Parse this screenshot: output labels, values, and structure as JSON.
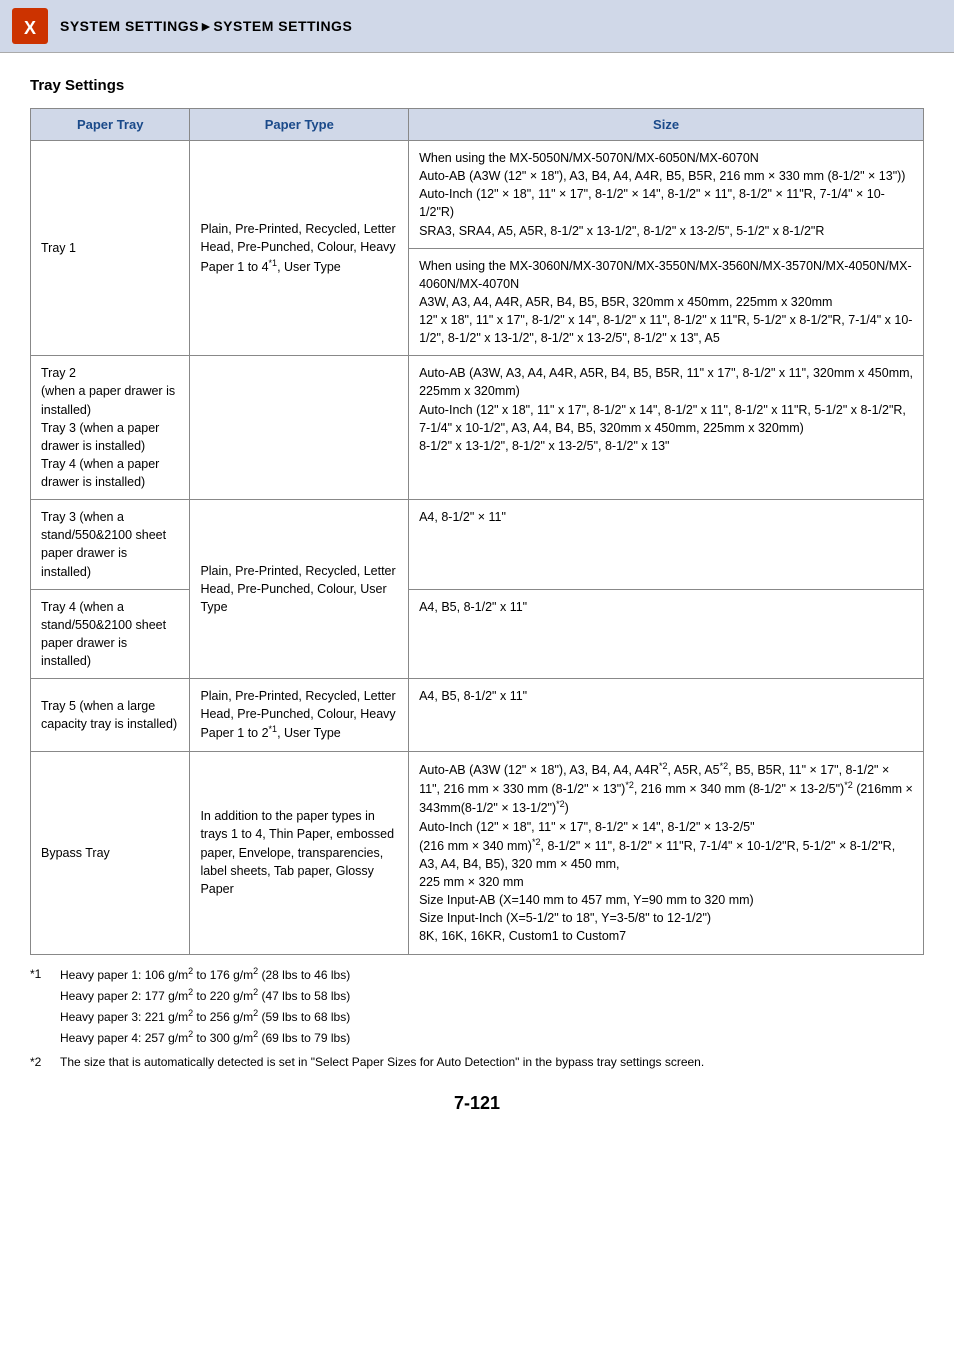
{
  "header": {
    "title": "SYSTEM SETTINGS►SYSTEM SETTINGS",
    "logo_alt": "Sharp logo"
  },
  "page_title": "Tray Settings",
  "table": {
    "headers": [
      "Paper Tray",
      "Paper Type",
      "Size"
    ],
    "rows": [
      {
        "tray": "Tray 1",
        "paper_type": "Plain, Pre-Printed, Recycled, Letter Head, Pre-Punched, Colour, Heavy Paper 1 to 4*1, User Type",
        "sizes": [
          "When using the MX-5050N/MX-5070N/MX-6050N/MX-6070N\nAuto-AB (A3W (12\" × 18\"), A3, B4, A4, A4R, B5, B5R, 216 mm × 330 mm (8-1/2\" × 13\"))\nAuto-Inch (12\" × 18\", 11\" × 17\", 8-1/2\" × 14\", 8-1/2\" × 11\", 8-1/2\" × 11\"R, 7-1/4\" × 10-1/2\"R)\nSRA3, SRA4, A5, A5R, 8-1/2\" x 13-1/2\", 8-1/2\" x 13-2/5\", 5-1/2\" x 8-1/2\"R",
          "When using the MX-3060N/MX-3070N/MX-3550N/MX-3560N/MX-3570N/MX-4050N/MX-4060N/MX-4070N\nA3W, A3, A4, A4R, A5R, B4, B5, B5R, 320mm x 450mm, 225mm x 320mm\n12\" x 18\", 11\" x 17\", 8-1/2\" x 14\", 8-1/2\" x 11\", 8-1/2\" x 11\"R, 5-1/2\" x 8-1/2\"R, 7-1/4\" x 10-1/2\", 8-1/2\" x 13-1/2\", 8-1/2\" x 13-2/5\", 8-1/2\" x 13\", A5"
        ]
      },
      {
        "tray": "Tray 2\n(when a paper drawer is installed)\nTray 3 (when a paper drawer is installed)\nTray 4 (when a paper drawer is installed)",
        "paper_type": "",
        "sizes": [
          "Auto-AB (A3W, A3, A4, A4R, A5R, B4, B5, B5R, 11\" x 17\", 8-1/2\" x 11\", 320mm x 450mm, 225mm x 320mm)\nAuto-Inch (12\" x 18\", 11\" x 17\", 8-1/2\" x 14\", 8-1/2\" x 11\", 8-1/2\" x 11\"R, 5-1/2\" x 8-1/2\"R, 7-1/4\" x 10-1/2\", A3, A4, B4, B5, 320mm x 450mm, 225mm x 320mm)\n8-1/2\" x 13-1/2\", 8-1/2\" x 13-2/5\", 8-1/2\" x 13\""
        ]
      },
      {
        "tray": "Tray 3 (when a stand/550&2100 sheet paper drawer is installed)",
        "paper_type": "Plain, Pre-Printed, Recycled, Letter Head, Pre-Punched, Colour, User Type",
        "sizes": [
          "A4, 8-1/2\" × 11\""
        ]
      },
      {
        "tray": "Tray 4 (when a stand/550&2100 sheet paper drawer is installed)",
        "paper_type": "",
        "sizes": [
          "A4, B5, 8-1/2\" x 11\""
        ]
      },
      {
        "tray": "Tray 5 (when a large capacity tray is installed)",
        "paper_type": "Plain, Pre-Printed, Recycled, Letter Head, Pre-Punched, Colour, Heavy Paper 1 to 2*1, User Type",
        "sizes": [
          "A4, B5, 8-1/2\" x 11\""
        ]
      },
      {
        "tray": "Bypass Tray",
        "paper_type": "In addition to the paper types in trays 1 to 4, Thin Paper, embossed paper, Envelope, transparencies, label sheets, Tab paper, Glossy Paper",
        "sizes": [
          "Auto-AB (A3W (12\" × 18\"), A3, B4, A4, A4R*2, A5R, A5*2, B5, B5R, 11\" × 17\", 8-1/2\" × 11\", 216 mm × 330 mm (8-1/2\" × 13\")*2, 216 mm × 340 mm (8-1/2\" × 13-2/5\")*2 (216mm × 343mm(8-1/2\" × 13-1/2\")*2)\nAuto-Inch (12\" × 18\", 11\" × 17\", 8-1/2\" × 14\", 8-1/2\" × 13-2/5\"\n(216 mm × 340 mm)*2, 8-1/2\" × 11\", 8-1/2\" × 11\"R, 7-1/4\" × 10-1/2\"R, 5-1/2\" × 8-1/2\"R, A3, A4, B4, B5), 320 mm × 450 mm,\n225 mm × 320 mm\nSize Input-AB (X=140 mm to 457 mm, Y=90 mm to 320 mm)\nSize Input-Inch (X=5-1/2\" to 18\", Y=3-5/8\" to 12-1/2\")\n8K, 16K, 16KR, Custom1 to Custom7"
        ]
      }
    ]
  },
  "footnotes": [
    {
      "ref": "*1",
      "lines": [
        "Heavy paper 1: 106 g/m² to 176 g/m² (28 lbs to 46 lbs)",
        "Heavy paper 2: 177 g/m² to 220 g/m² (47 lbs to 58 lbs)",
        "Heavy paper 3: 221 g/m² to 256 g/m² (59 lbs to 68 lbs)",
        "Heavy paper 4: 257 g/m² to 300 g/m² (69 lbs to 79 lbs)"
      ]
    },
    {
      "ref": "*2",
      "lines": [
        "The size that is automatically detected is set in \"Select Paper Sizes for Auto Detection\" in the bypass tray settings screen."
      ]
    }
  ],
  "page_number": "7-121"
}
